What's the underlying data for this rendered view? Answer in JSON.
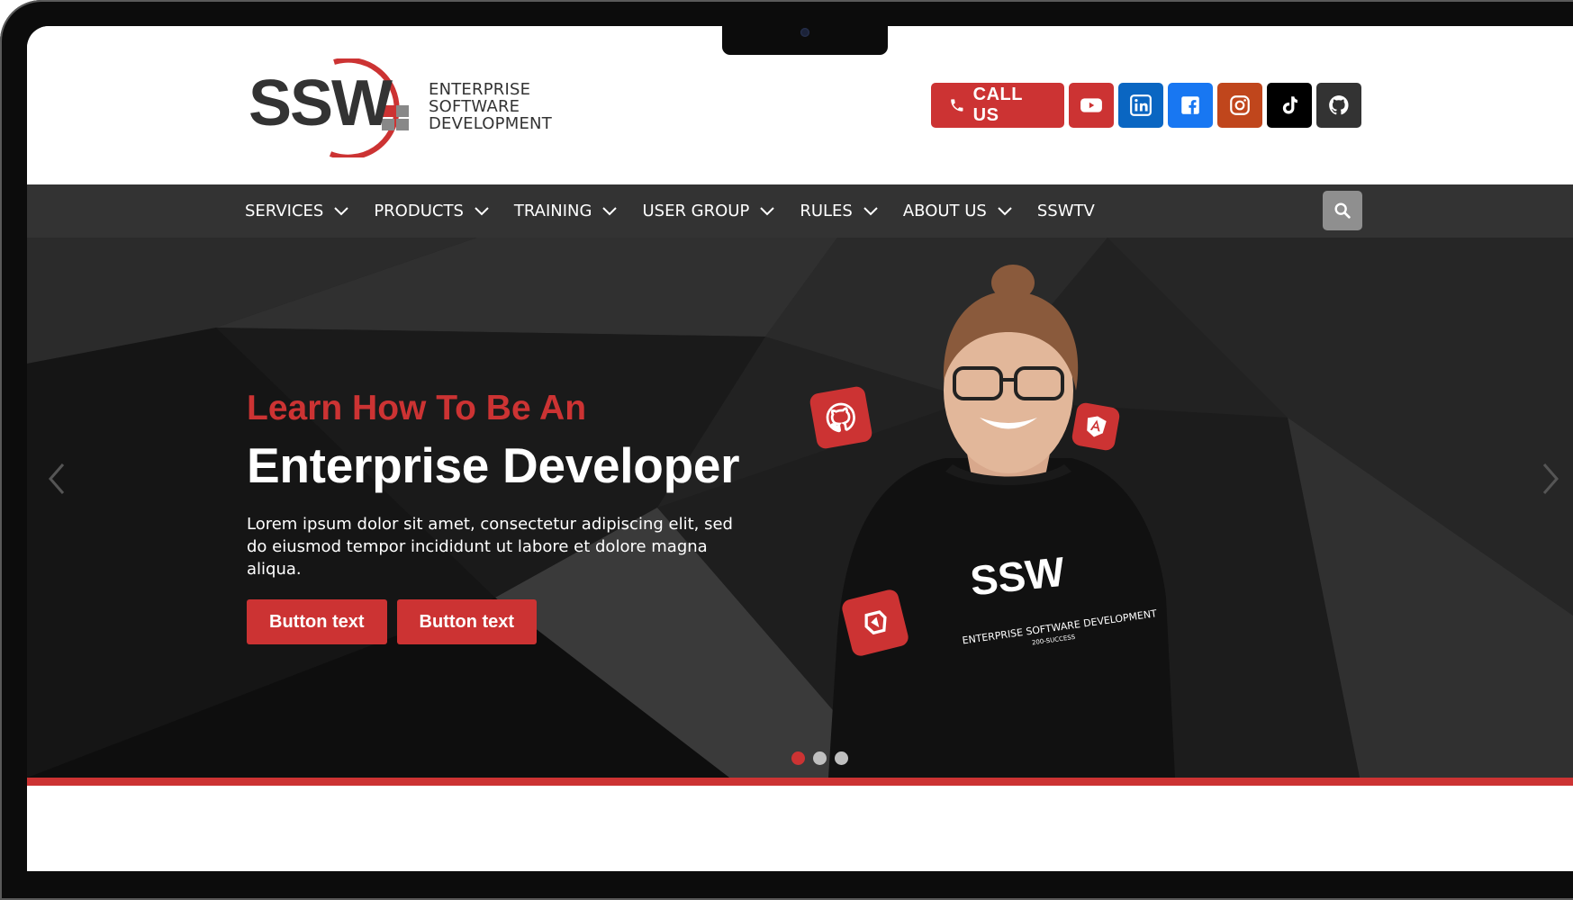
{
  "brand": {
    "logo_text": "SSW",
    "tagline": [
      "ENTERPRISE",
      "SOFTWARE",
      "DEVELOPMENT"
    ],
    "accent_color": "#cc3333",
    "dark_color": "#333333"
  },
  "header": {
    "call_label": "CALL US",
    "social": [
      {
        "name": "youtube",
        "color": "#cc3333"
      },
      {
        "name": "linkedin",
        "color": "#0a66c2"
      },
      {
        "name": "facebook",
        "color": "#1877f2"
      },
      {
        "name": "instagram",
        "color": "#c0461c"
      },
      {
        "name": "tiktok",
        "color": "#000000"
      },
      {
        "name": "github",
        "color": "#333333"
      }
    ]
  },
  "nav": {
    "items": [
      {
        "label": "SERVICES",
        "has_dropdown": true
      },
      {
        "label": "PRODUCTS",
        "has_dropdown": true
      },
      {
        "label": "TRAINING",
        "has_dropdown": true
      },
      {
        "label": "USER GROUP",
        "has_dropdown": true
      },
      {
        "label": "RULES",
        "has_dropdown": true
      },
      {
        "label": "ABOUT US",
        "has_dropdown": true
      },
      {
        "label": "SSWTV",
        "has_dropdown": false
      }
    ],
    "search_icon": "search-icon"
  },
  "hero": {
    "pre_title": "Learn How To Be An",
    "title": "Enterprise Developer",
    "description": "Lorem ipsum dolor sit amet, consectetur adipiscing elit, sed do eiusmod tempor incididunt ut labore et dolore magna aliqua.",
    "buttons": [
      "Button text",
      "Button text"
    ],
    "shirt_logo": "SSW",
    "shirt_text": "ENTERPRISE SOFTWARE DEVELOPMENT",
    "shirt_subtext": "200-SUCCESS",
    "slides": {
      "count": 3,
      "active": 1
    }
  }
}
